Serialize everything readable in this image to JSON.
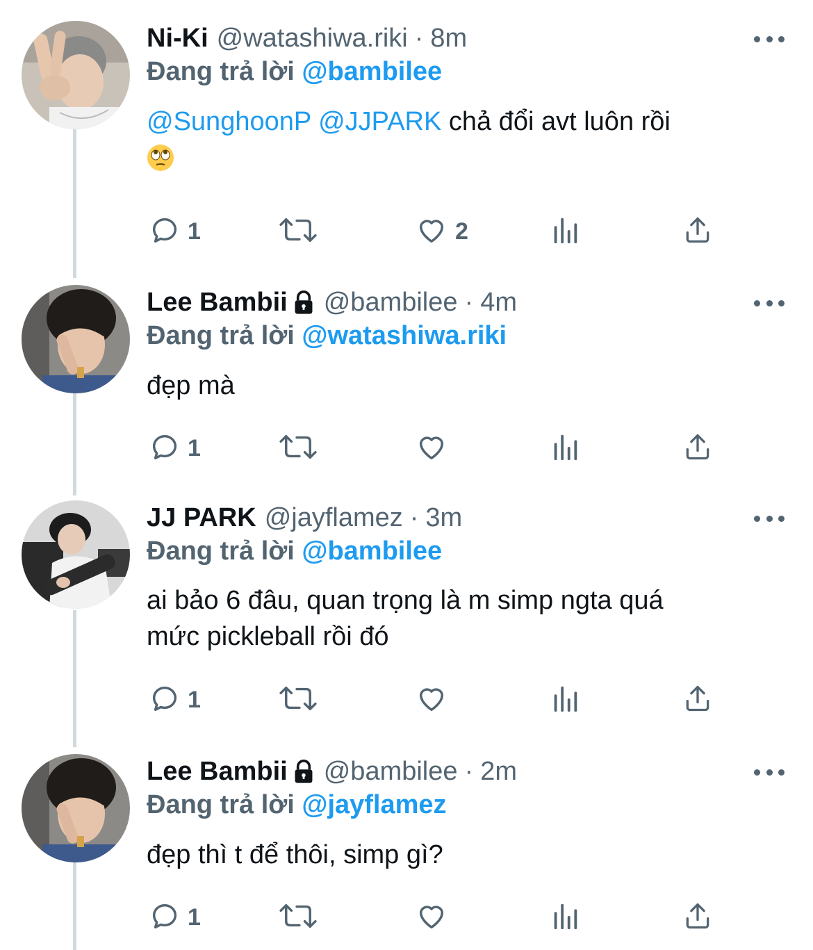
{
  "tweets": [
    {
      "name": "Ni-Ki",
      "handle": "@watashiwa.riki",
      "sep": "·",
      "time": "8m",
      "locked": false,
      "reply_prefix": "Đang trả lời",
      "reply_to": "@bambilee",
      "mention_1": "@SunghoonP",
      "mention_2": "@JJPARK",
      "text": "chả đổi avt luôn rồi",
      "emoji": "face-with-rolling-eyes",
      "replies": "1",
      "retweets": "",
      "likes": "2"
    },
    {
      "name": "Lee Bambii",
      "handle": "@bambilee",
      "sep": "·",
      "time": "4m",
      "locked": true,
      "reply_prefix": "Đang trả lời",
      "reply_to": "@watashiwa.riki",
      "text": "đẹp mà",
      "replies": "1",
      "retweets": "",
      "likes": ""
    },
    {
      "name": "JJ PARK",
      "handle": "@jayflamez",
      "sep": "·",
      "time": "3m",
      "locked": false,
      "reply_prefix": "Đang trả lời",
      "reply_to": "@bambilee",
      "text_line_1": "ai bảo 6 đâu, quan trọng là m simp ngta quá",
      "text_line_2": "mức pickleball rồi đó",
      "replies": "1",
      "retweets": "",
      "likes": ""
    },
    {
      "name": "Lee Bambii",
      "handle": "@bambilee",
      "sep": "·",
      "time": "2m",
      "locked": true,
      "reply_prefix": "Đang trả lời",
      "reply_to": "@jayflamez",
      "text": "đẹp thì t để thôi, simp gì?",
      "replies": "1",
      "retweets": "",
      "likes": ""
    }
  ],
  "icons": {
    "reply": "speech-bubble-icon",
    "retweet": "retweet-arrows-icon",
    "like": "heart-icon",
    "views": "bar-chart-icon",
    "share": "share-upload-icon",
    "more": "more-dots-icon",
    "lock": "lock-icon"
  },
  "colors": {
    "text": "#0f1419",
    "secondary": "#536471",
    "accent": "#1d9bf0",
    "thread_line": "#cfd9de"
  }
}
